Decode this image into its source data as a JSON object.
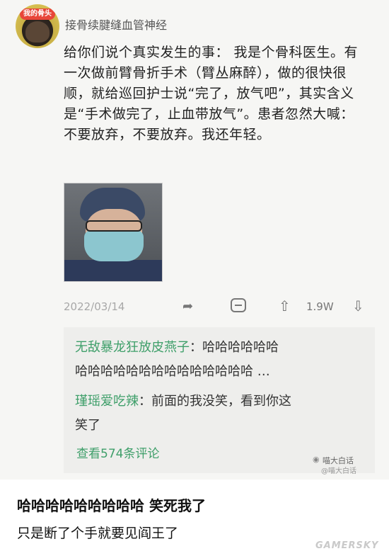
{
  "post": {
    "avatar_badge": "我的骨头",
    "username": "接骨续腱缝血管神经",
    "text": "给你们说个真实发生的事： 我是个骨科医生。有一次做前臂骨折手术（臂丛麻醉），做的很快很顺，就给巡回护士说“完了，放气吧”，其实含义是“手术做完了，止血带放气”。患者忽然大喊：不要放弃，不要放弃。我还年轻。",
    "date": "2022/03/14",
    "likes": "1.9W"
  },
  "comments": {
    "items": [
      {
        "user": "无敌暴龙狂放皮燕子",
        "sep": "：",
        "line1": "哈哈哈哈哈哈",
        "line2": "哈哈哈哈哈哈哈哈哈哈哈哈哈哈 …"
      },
      {
        "user": "瑾瑶爱吃辣",
        "sep": "：",
        "line1": "前面的我没笑，看到你这",
        "line2": "笑了"
      }
    ],
    "view_more": "查看574条评论"
  },
  "watermark": {
    "name": "喵大白话",
    "sub": "@喵大白话"
  },
  "captions": {
    "line1": "哈哈哈哈哈哈哈哈哈 笑死我了",
    "line2": "只是断了个手就要见阎王了"
  },
  "site_watermark": "GAMERSKY",
  "icons": [
    "share-icon",
    "comment-icon",
    "thumb-up-icon",
    "thumb-down-icon"
  ],
  "colors": {
    "accent_green": "#3f9f6a",
    "card_bg": "#f6f6f4",
    "comment_bg": "#eeeeec"
  }
}
